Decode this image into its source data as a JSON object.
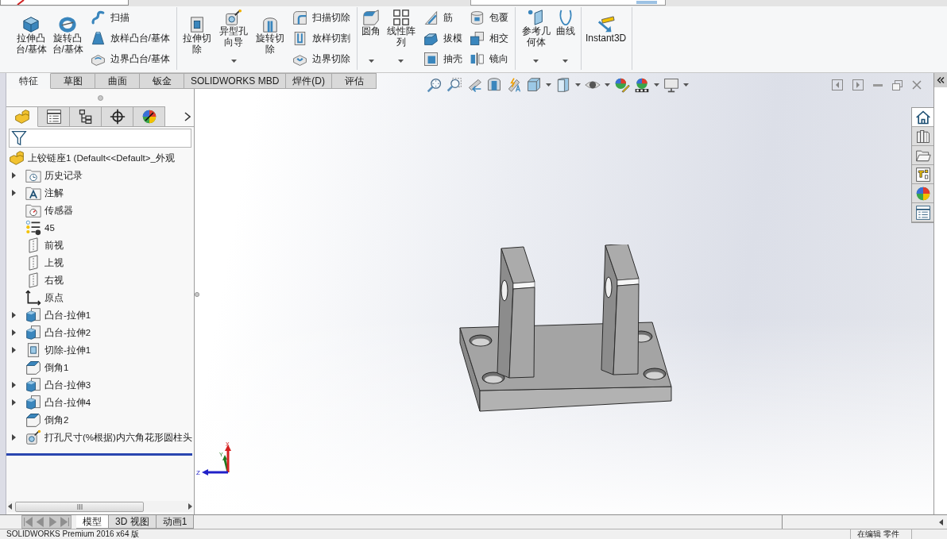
{
  "ribbon": {
    "groups": [
      {
        "commands": [
          {
            "kind": "large",
            "label": "拉伸凸台/基体",
            "dropdown": false
          },
          {
            "kind": "large",
            "label": "旋转凸台/基体",
            "dropdown": false
          },
          {
            "kind": "stack",
            "items": [
              {
                "label": "扫描"
              },
              {
                "label": "放样凸台/基体"
              },
              {
                "label": "边界凸台/基体"
              }
            ]
          }
        ]
      },
      {
        "commands": [
          {
            "kind": "large",
            "label": "拉伸切除",
            "dropdown": false
          },
          {
            "kind": "large",
            "label": "异型孔向导",
            "dropdown": true
          },
          {
            "kind": "large",
            "label": "旋转切除",
            "dropdown": false
          },
          {
            "kind": "stack",
            "items": [
              {
                "label": "扫描切除"
              },
              {
                "label": "放样切割"
              },
              {
                "label": "边界切除"
              }
            ]
          }
        ]
      },
      {
        "commands": [
          {
            "kind": "large",
            "label": "圆角",
            "dropdown": true
          },
          {
            "kind": "large",
            "label": "线性阵列",
            "dropdown": true
          },
          {
            "kind": "stack",
            "items": [
              {
                "label": "筋"
              },
              {
                "label": "拔模"
              },
              {
                "label": "抽壳"
              }
            ]
          },
          {
            "kind": "stack",
            "items": [
              {
                "label": "包覆"
              },
              {
                "label": "相交"
              },
              {
                "label": "镜向"
              }
            ]
          }
        ]
      },
      {
        "commands": [
          {
            "kind": "large",
            "label": "参考几何体",
            "dropdown": true
          },
          {
            "kind": "large",
            "label": "曲线",
            "dropdown": true
          }
        ]
      },
      {
        "commands": [
          {
            "kind": "large",
            "label": "Instant3D",
            "dropdown": false
          }
        ]
      }
    ]
  },
  "tabs": [
    {
      "label": "特征",
      "selected": true
    },
    {
      "label": "草图",
      "selected": false
    },
    {
      "label": "曲面",
      "selected": false
    },
    {
      "label": "钣金",
      "selected": false
    },
    {
      "label": "SOLIDWORKS MBD",
      "selected": false
    },
    {
      "label": "焊件(D)",
      "selected": false
    },
    {
      "label": "评估",
      "selected": false
    }
  ],
  "feature_panel": {
    "tabs": [
      {
        "selected": true
      },
      {
        "selected": false
      },
      {
        "selected": false
      },
      {
        "selected": false
      },
      {
        "selected": false
      }
    ],
    "tree": {
      "kind": "part",
      "label": "上铰链座1 (Default<<Default>_外观",
      "children": [
        {
          "kind": "history",
          "label": "历史记录",
          "expandable": true
        },
        {
          "kind": "annotations",
          "label": "注解",
          "expandable": true
        },
        {
          "kind": "sensors",
          "label": "传感器",
          "expandable": false
        },
        {
          "kind": "equations",
          "label": "45",
          "expandable": false
        },
        {
          "kind": "plane",
          "label": "前视",
          "expandable": false
        },
        {
          "kind": "plane",
          "label": "上视",
          "expandable": false
        },
        {
          "kind": "plane",
          "label": "右视",
          "expandable": false
        },
        {
          "kind": "origin",
          "label": "原点",
          "expandable": false
        },
        {
          "kind": "boss",
          "label": "凸台-拉伸1",
          "expandable": true
        },
        {
          "kind": "boss",
          "label": "凸台-拉伸2",
          "expandable": true
        },
        {
          "kind": "cut",
          "label": "切除-拉伸1",
          "expandable": true
        },
        {
          "kind": "chamfer",
          "label": "倒角1",
          "expandable": false
        },
        {
          "kind": "boss",
          "label": "凸台-拉伸3",
          "expandable": true
        },
        {
          "kind": "boss",
          "label": "凸台-拉伸4",
          "expandable": true
        },
        {
          "kind": "chamfer",
          "label": "倒角2",
          "expandable": false
        },
        {
          "kind": "hole",
          "label": "打孔尺寸(%根据)内六角花形圆柱头",
          "expandable": true
        }
      ]
    }
  },
  "heads_up_toolbar": [
    {
      "dropdown": false
    },
    {
      "dropdown": false
    },
    {
      "dropdown": false
    },
    {
      "dropdown": false
    },
    {
      "dropdown": false
    },
    {
      "dropdown": true
    },
    {
      "dropdown": true
    },
    {
      "dropdown": true
    },
    {
      "dropdown": false
    },
    {
      "dropdown": true
    },
    {
      "dropdown": true
    }
  ],
  "triad": {
    "x": "X",
    "y": "Y",
    "z": "Z"
  },
  "task_pane": {
    "tabs": [
      {
        "selected": true
      },
      {
        "selected": false
      },
      {
        "selected": false
      },
      {
        "selected": false
      },
      {
        "selected": false
      },
      {
        "selected": false
      }
    ]
  },
  "bottom_tabs": {
    "nav_disabled": true,
    "tabs": [
      {
        "label": "模型",
        "selected": true
      },
      {
        "label": "3D 视图",
        "selected": false
      },
      {
        "label": "动画1",
        "selected": false
      }
    ]
  },
  "status_bar": {
    "product": "SOLIDWORKS Premium 2016 x64 版",
    "mode": "在编辑 零件"
  }
}
